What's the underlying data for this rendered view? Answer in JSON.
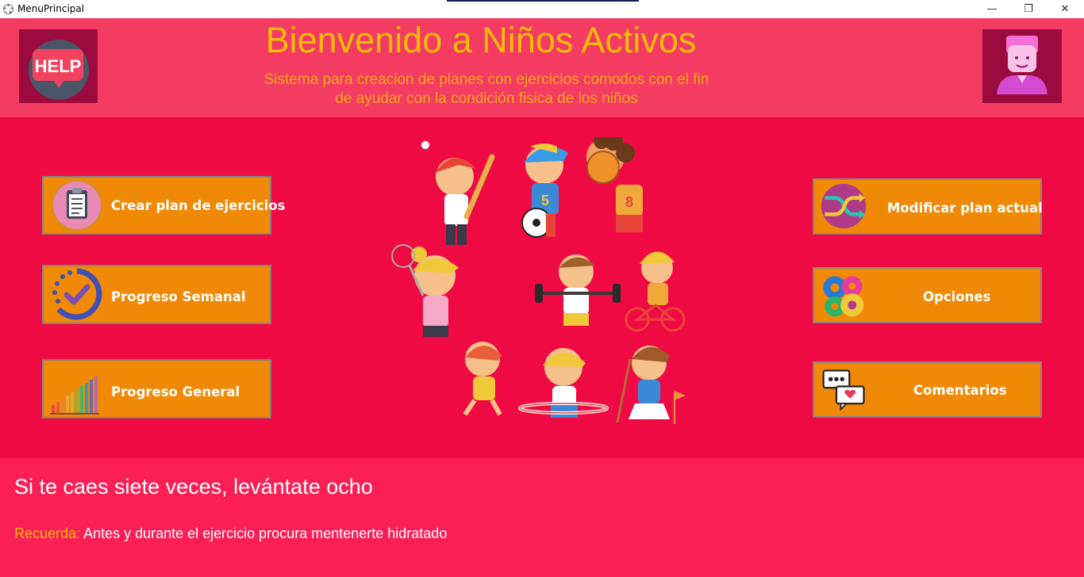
{
  "window": {
    "title": "MenuPrincipal",
    "controls": {
      "minimize": "—",
      "maximize": "❐",
      "close": "✕"
    }
  },
  "header": {
    "title": "Bienvenido a Niños Activos",
    "subtitle_line1": "Sistema para creacion de planes con ejercicios comodos con el fin",
    "subtitle_line2": "de ayudar con la condición fisica de los niños",
    "help_icon_text": "HELP"
  },
  "menu": {
    "left": [
      {
        "label": "Crear plan de ejercicios",
        "icon": "clipboard-icon"
      },
      {
        "label": "Progreso Semanal",
        "icon": "progress-check-icon"
      },
      {
        "label": "Progreso General",
        "icon": "bar-chart-icon"
      }
    ],
    "right": [
      {
        "label": "Modificar plan actual",
        "icon": "shuffle-icon"
      },
      {
        "label": "Opciones",
        "icon": "gears-icon"
      },
      {
        "label": "Comentarios",
        "icon": "chat-bubbles-icon"
      }
    ]
  },
  "footer": {
    "quote": "Si te caes siete veces, levántate ocho",
    "reminder_label": "Recuerda:",
    "reminder_text": " Antes y durante el ejercicio procura mentenerte hidratado"
  },
  "colors": {
    "header_bg": "#f43b61",
    "main_bg": "#f00a44",
    "footer_bg": "#fb1f55",
    "button_bg": "#f08a06",
    "title_color": "#f7bc09",
    "icon_box_bg": "#9c0b3d"
  }
}
